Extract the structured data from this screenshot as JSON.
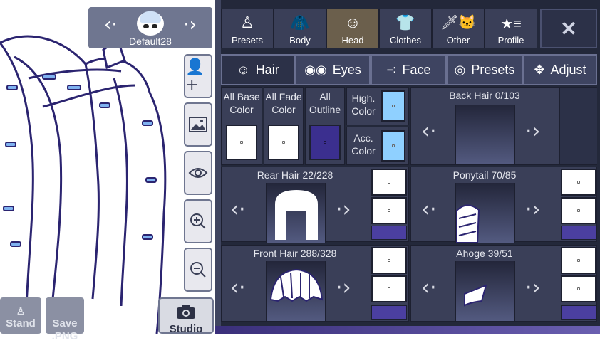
{
  "character": {
    "name": "Default28"
  },
  "left_buttons": {
    "stand": "Stand",
    "save": "Save\n.PNG",
    "studio": "Studio"
  },
  "top_tabs": [
    {
      "label": "Presets",
      "icon": "preset-figure-icon"
    },
    {
      "label": "Body",
      "icon": "jacket-icon"
    },
    {
      "label": "Head",
      "icon": "head-icon",
      "selected": true
    },
    {
      "label": "Clothes",
      "icon": "shirt-icon"
    },
    {
      "label": "Other",
      "icon": "sword-cat-icon"
    },
    {
      "label": "Profile",
      "icon": "star-list-icon"
    }
  ],
  "close_label": "✕",
  "sub_tabs": [
    {
      "label": "Hair",
      "icon": "hair-icon",
      "selected": true
    },
    {
      "label": "Eyes",
      "icon": "eyes-icon"
    },
    {
      "label": "Face",
      "icon": "face-icon"
    },
    {
      "label": "Presets",
      "icon": "face-preset-icon"
    },
    {
      "label": "Adjust",
      "icon": "move-icon"
    }
  ],
  "color_controls": {
    "all_base": "All Base\nColor",
    "all_fade": "All Fade\nColor",
    "all_outline": "All\nOutline",
    "high": "High.\nColor",
    "acc": "Acc.\nColor"
  },
  "colors": {
    "base": "#ffffff",
    "fade": "#ffffff",
    "outline": "#3b2f8f",
    "highlight": "#8fd0ff",
    "accent": "#8fd0ff",
    "bar": "#4b3fa0"
  },
  "parts": {
    "back_hair": "Back Hair 0/103",
    "rear_hair": "Rear Hair 22/228",
    "ponytail": "Ponytail 70/85",
    "front_hair": "Front Hair 288/328",
    "ahoge": "Ahoge 39/51"
  }
}
